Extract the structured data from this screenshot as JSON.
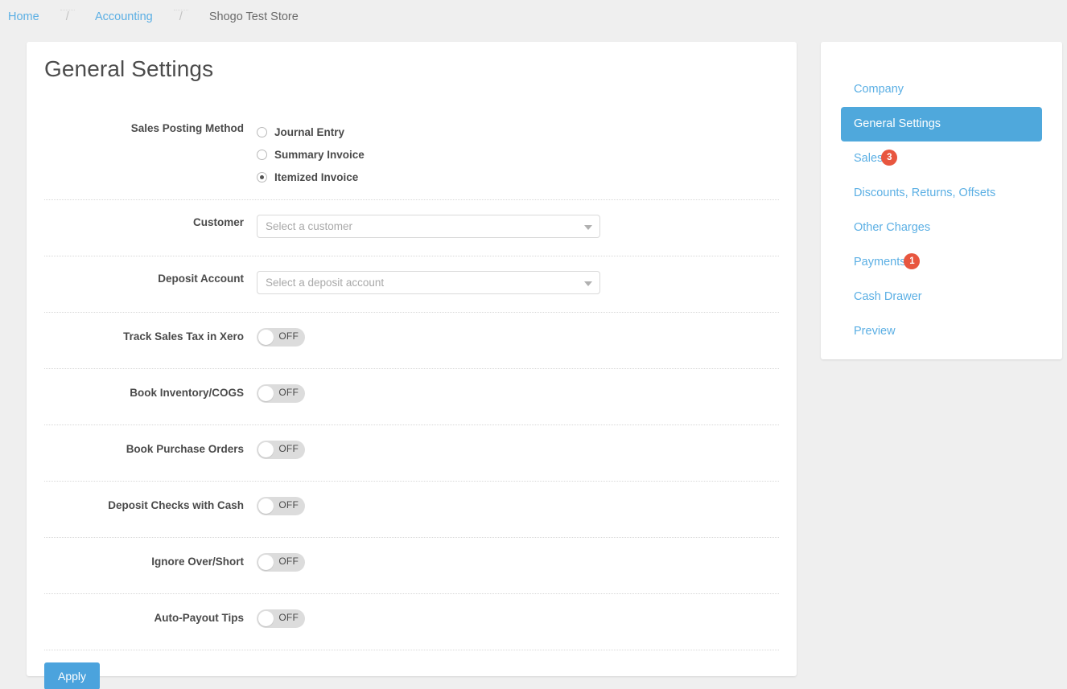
{
  "breadcrumb": {
    "items": [
      {
        "label": "Home",
        "link": true
      },
      {
        "label": "Accounting",
        "link": true
      },
      {
        "label": "Shogo Test Store",
        "link": false
      }
    ],
    "separator": "/"
  },
  "main": {
    "title": "General Settings",
    "posting_method": {
      "label": "Sales Posting Method",
      "options": [
        {
          "label": "Journal Entry",
          "selected": false
        },
        {
          "label": "Summary Invoice",
          "selected": false
        },
        {
          "label": "Itemized Invoice",
          "selected": true
        }
      ]
    },
    "customer": {
      "label": "Customer",
      "value": "",
      "placeholder": "Select a customer"
    },
    "deposit_account": {
      "label": "Deposit Account",
      "value": "",
      "placeholder": "Select a deposit account"
    },
    "toggles": [
      {
        "label": "Track Sales Tax in Xero",
        "state": "OFF",
        "on": false
      },
      {
        "label": "Book Inventory/COGS",
        "state": "OFF",
        "on": false
      },
      {
        "label": "Book Purchase Orders",
        "state": "OFF",
        "on": false
      },
      {
        "label": "Deposit Checks with Cash",
        "state": "OFF",
        "on": false
      },
      {
        "label": "Ignore Over/Short",
        "state": "OFF",
        "on": false
      },
      {
        "label": "Auto-Payout Tips",
        "state": "OFF",
        "on": false
      }
    ],
    "apply_label": "Apply"
  },
  "sidebar": {
    "items": [
      {
        "label": "Company",
        "active": false,
        "badge": ""
      },
      {
        "label": "General Settings",
        "active": true,
        "badge": ""
      },
      {
        "label": "Sales",
        "active": false,
        "badge": "3"
      },
      {
        "label": "Discounts, Returns, Offsets",
        "active": false,
        "badge": ""
      },
      {
        "label": "Other Charges",
        "active": false,
        "badge": ""
      },
      {
        "label": "Payments",
        "active": false,
        "badge": "1"
      },
      {
        "label": "Cash Drawer",
        "active": false,
        "badge": ""
      },
      {
        "label": "Preview",
        "active": false,
        "badge": ""
      }
    ]
  },
  "colors": {
    "accent_blue": "#4fa8dc",
    "link_blue": "#5bafe4",
    "badge_red": "#e8563f",
    "page_bg": "#efefef",
    "label_text": "#4a4a4a"
  }
}
